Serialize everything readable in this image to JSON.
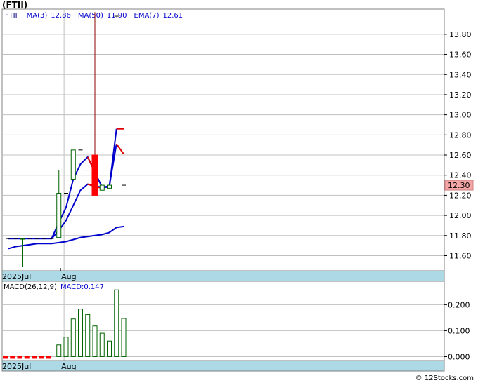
{
  "title": "(FTII)",
  "watermark": "© 12Stocks.com",
  "chart_data": [
    {
      "type": "candlestick",
      "legend": [
        {
          "label": "FTII",
          "color": "#000080"
        },
        {
          "label": "MA(3)",
          "value": "12.86",
          "color": "#0000cc"
        },
        {
          "label": "MA(50)",
          "value": "11.90",
          "color": "#0000cc"
        },
        {
          "label": "EMA(7)",
          "value": "12.61",
          "color": "#0000cc"
        }
      ],
      "last_price_label": "12.30",
      "ylim": [
        11.45,
        14.05
      ],
      "yticks": [
        "11.60",
        "11.80",
        "12.00",
        "12.20",
        "12.40",
        "12.60",
        "12.80",
        "13.00",
        "13.20",
        "13.40",
        "13.60",
        "13.80"
      ],
      "date_labels": [
        {
          "label": "2025Jul",
          "index": 0
        },
        {
          "label": "Aug",
          "index": 8.5
        }
      ],
      "candles": [
        {
          "i": 0,
          "o": 11.77,
          "h": 11.77,
          "l": 11.77,
          "c": 11.77
        },
        {
          "i": 1,
          "o": 11.77,
          "h": 11.77,
          "l": 11.77,
          "c": 11.77
        },
        {
          "i": 2,
          "o": 11.77,
          "h": 11.77,
          "l": 11.49,
          "c": 11.77
        },
        {
          "i": 3,
          "o": 11.77,
          "h": 11.77,
          "l": 11.77,
          "c": 11.77
        },
        {
          "i": 4,
          "o": 11.77,
          "h": 11.77,
          "l": 11.77,
          "c": 11.77
        },
        {
          "i": 5,
          "o": 11.77,
          "h": 11.77,
          "l": 11.77,
          "c": 11.77
        },
        {
          "i": 6,
          "o": 11.77,
          "h": 11.77,
          "l": 11.77,
          "c": 11.77
        },
        {
          "i": 7,
          "o": 11.78,
          "h": 12.45,
          "l": 11.78,
          "c": 12.22
        },
        {
          "i": 8,
          "o": 12.22,
          "h": 12.22,
          "l": 12.22,
          "c": 12.22
        },
        {
          "i": 9,
          "o": 12.36,
          "h": 12.65,
          "l": 12.36,
          "c": 12.65
        },
        {
          "i": 10,
          "o": 12.65,
          "h": 12.65,
          "l": 12.65,
          "c": 12.65
        },
        {
          "i": 11,
          "o": 12.45,
          "h": 12.45,
          "l": 12.45,
          "c": 12.45
        },
        {
          "i": 12,
          "o": 12.6,
          "h": 14.02,
          "l": 12.2,
          "c": 12.2
        },
        {
          "i": 13,
          "o": 12.25,
          "h": 12.3,
          "l": 12.25,
          "c": 12.3
        },
        {
          "i": 14,
          "o": 12.27,
          "h": 12.3,
          "l": 12.27,
          "c": 12.3
        },
        {
          "i": 15,
          "o": 13.98,
          "h": 13.98,
          "l": 13.98,
          "c": 13.98
        },
        {
          "i": 16,
          "o": 12.3,
          "h": 12.3,
          "l": 12.3,
          "c": 12.3
        }
      ],
      "series": [
        {
          "name": "MA(3)",
          "color": "#0000cc",
          "points": [
            [
              0,
              11.77
            ],
            [
              1,
              11.77
            ],
            [
              2,
              11.77
            ],
            [
              3,
              11.77
            ],
            [
              4,
              11.77
            ],
            [
              5,
              11.77
            ],
            [
              6,
              11.77
            ],
            [
              7,
              11.93
            ],
            [
              8,
              12.08
            ],
            [
              9,
              12.36
            ],
            [
              10,
              12.51
            ],
            [
              11,
              12.58
            ],
            [
              12,
              12.43
            ],
            [
              13,
              12.28
            ],
            [
              14,
              12.28
            ],
            [
              15,
              12.86
            ]
          ]
        },
        {
          "name": "MA(3)",
          "color": "#e00000",
          "points": [
            [
              11,
              12.58
            ],
            [
              12,
              12.43
            ]
          ]
        },
        {
          "name": "MA(3)",
          "color": "#e00000",
          "points": [
            [
              15,
              12.86
            ],
            [
              16,
              12.86
            ]
          ]
        },
        {
          "name": "EMA(7)",
          "color": "#0000cc",
          "points": [
            [
              0,
              11.77
            ],
            [
              1,
              11.77
            ],
            [
              2,
              11.77
            ],
            [
              3,
              11.77
            ],
            [
              4,
              11.77
            ],
            [
              5,
              11.77
            ],
            [
              6,
              11.77
            ],
            [
              7,
              11.85
            ],
            [
              8,
              11.95
            ],
            [
              9,
              12.1
            ],
            [
              10,
              12.25
            ],
            [
              11,
              12.31
            ],
            [
              12,
              12.29
            ],
            [
              13,
              12.28
            ],
            [
              14,
              12.29
            ],
            [
              15,
              12.71
            ]
          ]
        },
        {
          "name": "EMA(7)",
          "color": "#e00000",
          "points": [
            [
              11,
              12.31
            ],
            [
              12,
              12.29
            ],
            [
              13,
              12.27
            ]
          ]
        },
        {
          "name": "EMA(7)",
          "color": "#e00000",
          "points": [
            [
              15,
              12.71
            ],
            [
              16,
              12.61
            ]
          ]
        },
        {
          "name": "MA(50)",
          "color": "#0000cc",
          "points": [
            [
              0,
              11.67
            ],
            [
              1,
              11.69
            ],
            [
              2,
              11.7
            ],
            [
              3,
              11.71
            ],
            [
              4,
              11.72
            ],
            [
              5,
              11.72
            ],
            [
              6,
              11.72
            ],
            [
              7,
              11.73
            ],
            [
              8,
              11.74
            ],
            [
              9,
              11.76
            ],
            [
              10,
              11.78
            ],
            [
              11,
              11.79
            ],
            [
              12,
              11.8
            ],
            [
              13,
              11.81
            ],
            [
              14,
              11.83
            ],
            [
              15,
              11.88
            ],
            [
              16,
              11.89
            ]
          ]
        }
      ]
    },
    {
      "type": "bar",
      "title": "MACD(26,12,9)",
      "legend_value_label": "MACD:0.147",
      "ylim": [
        -0.015,
        0.29
      ],
      "yticks": [
        "0.000",
        "0.100",
        "0.200"
      ],
      "date_labels": [
        {
          "label": "2025Jul",
          "index": 0
        },
        {
          "label": "Aug",
          "index": 8.5
        }
      ],
      "x": [
        0,
        1,
        2,
        3,
        4,
        5,
        6,
        7,
        8,
        9,
        10,
        11,
        12,
        13,
        14,
        15,
        16
      ],
      "values": [
        0.0,
        0.0,
        0.0,
        0.0,
        0.0,
        0.0,
        0.0,
        0.045,
        0.075,
        0.145,
        0.183,
        0.162,
        0.118,
        0.09,
        0.06,
        0.257,
        0.147
      ],
      "neg_marker_count": 7
    }
  ]
}
